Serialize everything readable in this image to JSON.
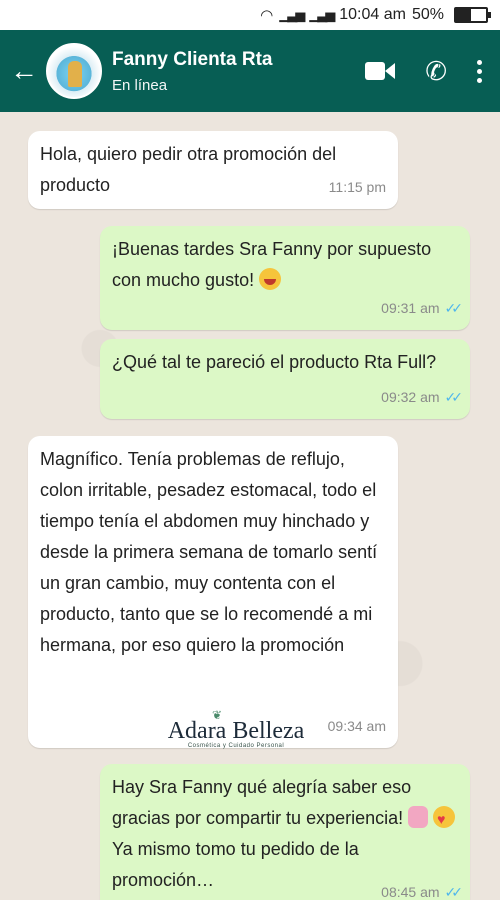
{
  "status_bar": {
    "time": "10:04 am",
    "battery": "50%"
  },
  "header": {
    "contact_name": "Fanny Clienta Rta",
    "presence": "En línea",
    "icons": [
      "back-arrow-icon",
      "video-call-icon",
      "phone-icon",
      "more-options-icon"
    ]
  },
  "messages": [
    {
      "direction": "in",
      "text": "Hola, quiero pedir otra promoción del producto",
      "time": "11:15 pm"
    },
    {
      "direction": "out",
      "text": "¡Buenas tardes Sra Fanny por supuesto con mucho gusto!",
      "emoji": "smile-emoji",
      "time": "09:31 am",
      "status": "read"
    },
    {
      "direction": "out",
      "text": "¿Qué tal te pareció el producto Rta Full?",
      "time": "09:32 am",
      "status": "read"
    },
    {
      "direction": "in",
      "text": "Magnífico. Tenía problemas de reflujo, colon irritable, pesadez estomacal, todo el tiempo tenía el abdomen muy hinchado y desde la primera semana de tomarlo sentí un gran cambio, muy contenta con el producto, tanto que se lo recomendé a mi hermana, por eso quiero la promoción",
      "time": "09:34 am"
    },
    {
      "direction": "out",
      "text_part1": "Hay Sra Fanny qué alegría saber eso gracias por compartir tu experiencia!",
      "text_part2": "Ya mismo tomo tu pedido de la promoción…",
      "time": "08:45 am",
      "status": "read"
    }
  ],
  "watermark": {
    "brand": "Adara Belleza",
    "tagline": "Cosmética y Cuidado Personal"
  },
  "colors": {
    "header_bg": "#075e54",
    "incoming_bubble": "#ffffff",
    "outgoing_bubble": "#dcf8c6",
    "read_ticks": "#4fb6ec",
    "chat_bg": "#ece5dd"
  }
}
